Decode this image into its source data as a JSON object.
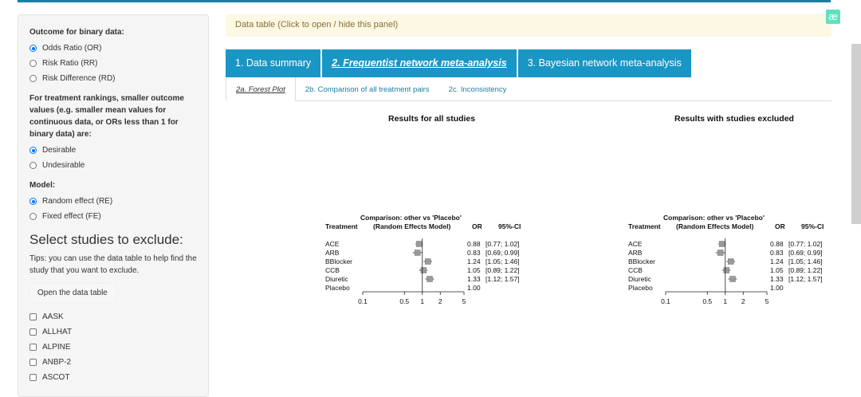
{
  "sidebar": {
    "outcome_label": "Outcome for binary data:",
    "outcome_options": [
      "Odds Ratio (OR)",
      "Risk Ratio (RR)",
      "Risk Difference (RD)"
    ],
    "ranking_label": "For treatment rankings, smaller outcome values (e.g. smaller mean values for continuous data, or ORs less than 1 for binary data) are:",
    "ranking_options": [
      "Desirable",
      "Undesirable"
    ],
    "model_label": "Model:",
    "model_options": [
      "Random effect (RE)",
      "Fixed effect (FE)"
    ],
    "exclude_title": "Select studies to exclude:",
    "tips": "Tips: you can use the data table to help find the study that you want to exclude.",
    "open_table_button": "Open the data table",
    "studies": [
      "AASK",
      "ALLHAT",
      "ALPINE",
      "ANBP-2",
      "ASCOT"
    ]
  },
  "main": {
    "panel_toggle": "Data table (Click to open / hide this panel)",
    "logo": "æ",
    "tabs": [
      "1. Data summary",
      "2. Frequentist network meta-analysis",
      "3. Bayesian network meta-analysis"
    ],
    "subtabs": [
      "2a. Forest Plot",
      "2b. Comparison of all treatment pairs",
      "2c. Inconsistency"
    ],
    "plot_left_title": "Results for all studies",
    "plot_right_title": "Results with studies excluded"
  },
  "forest": {
    "comparison": "Comparison: other vs 'Placebo'",
    "model": "(Random Effects Model)",
    "col_treatment": "Treatment",
    "col_or": "OR",
    "col_ci": "95%-CI",
    "rows": [
      {
        "t": "ACE",
        "or": "0.88",
        "ci": "[0.77; 1.02]",
        "v": 0.88,
        "lo": 0.77,
        "hi": 1.02
      },
      {
        "t": "ARB",
        "or": "0.83",
        "ci": "[0.69; 0.99]",
        "v": 0.83,
        "lo": 0.69,
        "hi": 0.99
      },
      {
        "t": "BBlocker",
        "or": "1.24",
        "ci": "[1.05; 1.46]",
        "v": 1.24,
        "lo": 1.05,
        "hi": 1.46
      },
      {
        "t": "CCB",
        "or": "1.05",
        "ci": "[0.89; 1.22]",
        "v": 1.05,
        "lo": 0.89,
        "hi": 1.22
      },
      {
        "t": "Diuretic",
        "or": "1.33",
        "ci": "[1.12; 1.57]",
        "v": 1.33,
        "lo": 1.12,
        "hi": 1.57
      },
      {
        "t": "Placebo",
        "or": "1.00",
        "ci": "",
        "v": null,
        "lo": null,
        "hi": null
      }
    ],
    "axis_ticks": [
      {
        "v": 0.1,
        "label": "0.1"
      },
      {
        "v": 0.5,
        "label": "0.5"
      },
      {
        "v": 1,
        "label": "1"
      },
      {
        "v": 2,
        "label": "2"
      },
      {
        "v": 5,
        "label": "5"
      }
    ]
  }
}
